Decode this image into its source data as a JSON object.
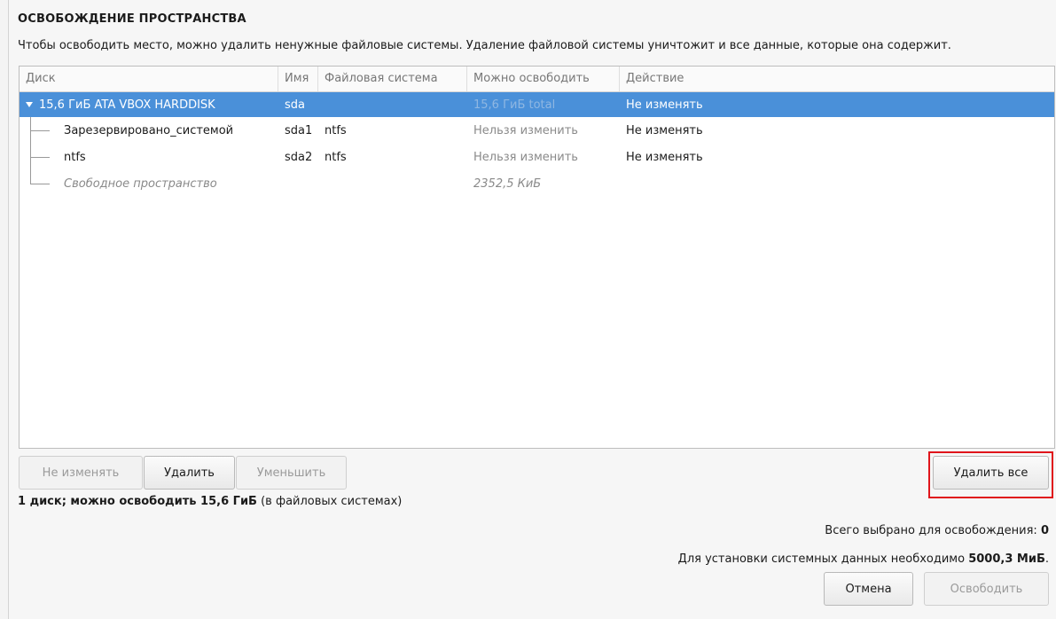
{
  "dialog": {
    "title": "ОСВОБОЖДЕНИЕ ПРОСТРАНСТВА",
    "description": "Чтобы освободить место, можно удалить ненужные файловые системы. Удаление файловой системы уничтожит и все данные, которые она содержит."
  },
  "table": {
    "columns": [
      "Диск",
      "Имя",
      "Файловая система",
      "Можно освободить",
      "Действие"
    ],
    "disk": {
      "label": "15,6 ГиБ ATA VBOX HARDDISK",
      "name": "sda",
      "fs": "",
      "reclaim": "15,6 ГиБ total",
      "action": "Не изменять"
    },
    "rows": [
      {
        "label": "Зарезервировано_системой",
        "name": "sda1",
        "fs": "ntfs",
        "reclaim": "Нельзя изменить",
        "action": "Не изменять"
      },
      {
        "label": "ntfs",
        "name": "sda2",
        "fs": "ntfs",
        "reclaim": "Нельзя изменить",
        "action": "Не изменять"
      },
      {
        "label": "Свободное пространство",
        "name": "",
        "fs": "",
        "reclaim": "2352,5 КиБ",
        "action": ""
      }
    ]
  },
  "actions": {
    "preserve": "Не изменять",
    "delete": "Удалить",
    "shrink": "Уменьшить",
    "delete_all": "Удалить все"
  },
  "summary": {
    "bold": "1 диск; можно освободить 15,6 ГиБ",
    "rest": " (в файловых системах)"
  },
  "total": {
    "label": "Всего выбрано для освобождения: ",
    "value": "0"
  },
  "required": {
    "label": "Для установки системных данных необходимо ",
    "value": "5000,3 МиБ",
    "suffix": "."
  },
  "footer": {
    "cancel": "Отмена",
    "reclaim": "Освободить"
  },
  "colors": {
    "selection": "#4a90d9",
    "highlight": "#e0151b"
  }
}
